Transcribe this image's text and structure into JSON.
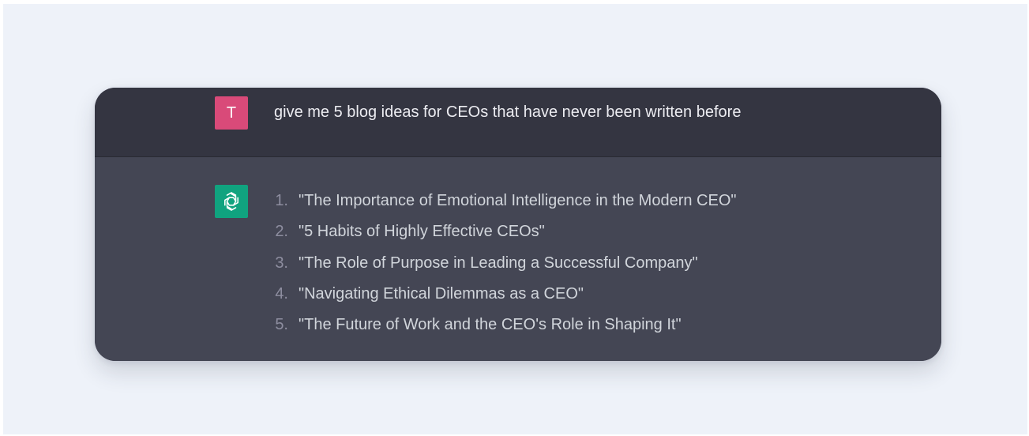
{
  "conversation": {
    "user": {
      "avatar_initial": "T",
      "avatar_color": "#d94a79",
      "message": "give me 5 blog ideas for CEOs that have never been written before"
    },
    "assistant": {
      "avatar_icon": "openai-logo-icon",
      "avatar_color": "#10a37f",
      "items": [
        {
          "number": "1.",
          "text": "\"The Importance of Emotional Intelligence in the Modern CEO\""
        },
        {
          "number": "2.",
          "text": "\"5 Habits of Highly Effective CEOs\""
        },
        {
          "number": "3.",
          "text": "\"The Role of Purpose in Leading a Successful Company\""
        },
        {
          "number": "4.",
          "text": "\"Navigating Ethical Dilemmas as a CEO\""
        },
        {
          "number": "5.",
          "text": "\"The Future of Work and the CEO's Role in Shaping It\""
        }
      ]
    }
  },
  "colors": {
    "page_background": "#eef2f9",
    "user_row_background": "#343541",
    "assistant_row_background": "#444654",
    "primary_text": "#ececf1",
    "list_text": "#d1d5db",
    "list_number": "#8e8ea0"
  }
}
